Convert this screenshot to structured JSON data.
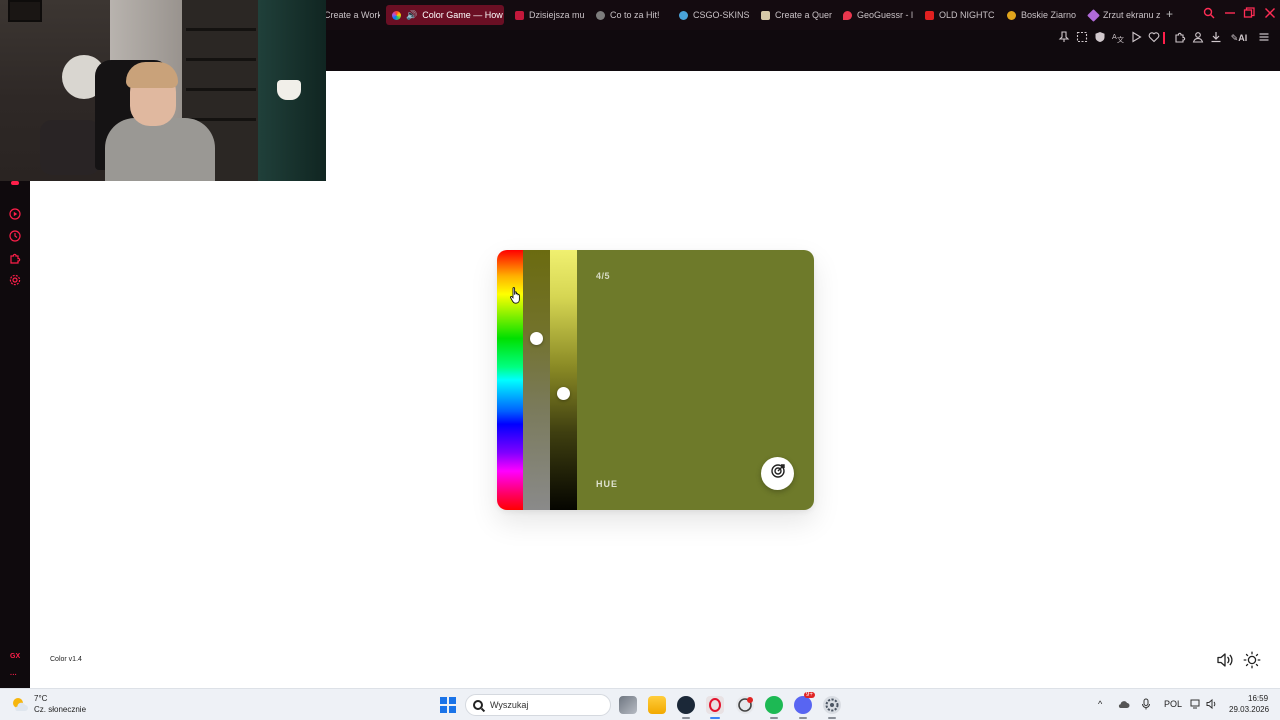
{
  "browser": {
    "tabs": [
      {
        "title": "Create a Work",
        "active": false,
        "favicon_color": "#3a3a3a"
      },
      {
        "title": "Color Game — How",
        "active": true,
        "favicon_color": "#e93a6a",
        "sound_icon": "speaker-icon"
      },
      {
        "title": "Dzisiejsza mu",
        "active": false,
        "favicon_color": "#c2183b"
      },
      {
        "title": "Co to za Hit!",
        "active": false,
        "favicon_color": "#7d7d7d"
      },
      {
        "title": "CSGO-SKINS",
        "active": false,
        "favicon_color": "#4aa3d8"
      },
      {
        "title": "Create a Quer",
        "active": false,
        "favicon_color": "#d6c8a8"
      },
      {
        "title": "GeoGuessr - l",
        "active": false,
        "favicon_color": "#e8374e"
      },
      {
        "title": "OLD NIGHTC",
        "active": false,
        "favicon_color": "#e02020"
      },
      {
        "title": "Boskie Ziarno",
        "active": false,
        "favicon_color": "#e0a41c"
      },
      {
        "title": "Zrzut ekranu z",
        "active": false,
        "favicon_color": "#b06ad8"
      }
    ],
    "new_tab_label": "+",
    "toolbar_ai_label": "AI",
    "accent_color": "#ff1f4a"
  },
  "sidebar": {
    "icons": [
      "player-icon",
      "history-icon",
      "extensions-icon",
      "settings-icon"
    ],
    "gx_label": "GX",
    "more_label": "···"
  },
  "game": {
    "progress": "4/5",
    "mode_label": "HUE",
    "submit_icon": "target-icon",
    "selected_color": "#6e7a2a",
    "hue_level": 0.17,
    "saturation_level": 0.34,
    "lightness_level": 0.55,
    "version": "Color v1.4",
    "sound_icon": "speaker-icon",
    "theme_icon": "sun-icon"
  },
  "taskbar": {
    "weather_temp": "7°C",
    "weather_desc": "Cz. słonecznie",
    "search_placeholder": "Wyszukaj",
    "language": "POL",
    "time": "16:59",
    "date": "29.03.2026",
    "apps": [
      "task-view-icon",
      "file-explorer-icon",
      "steam-icon",
      "opera-gx-icon",
      "spotify-icon",
      "xbox-icon",
      "discord-icon",
      "settings-icon"
    ],
    "discord_badge": "9+"
  }
}
